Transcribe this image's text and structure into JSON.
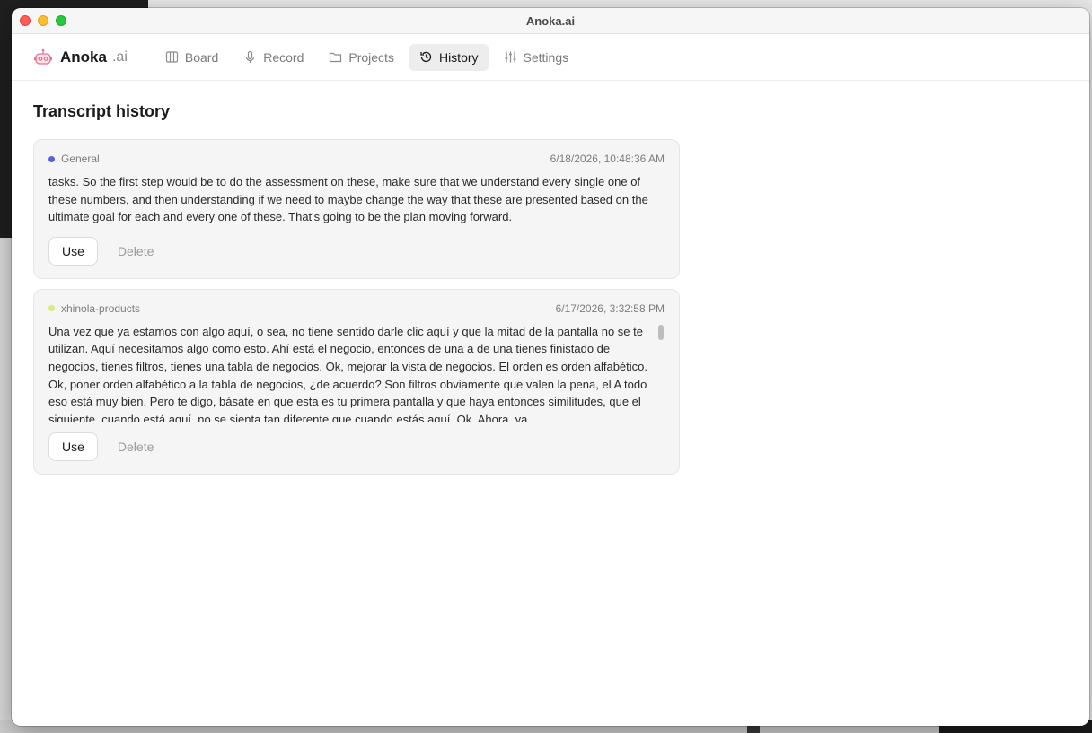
{
  "window": {
    "title": "Anoka.ai"
  },
  "brand": {
    "name": "Anoka",
    "suffix": ".ai"
  },
  "nav": [
    {
      "label": "Board",
      "icon": "board-icon",
      "active": false
    },
    {
      "label": "Record",
      "icon": "mic-icon",
      "active": false
    },
    {
      "label": "Projects",
      "icon": "folder-icon",
      "active": false
    },
    {
      "label": "History",
      "icon": "history-icon",
      "active": true
    },
    {
      "label": "Settings",
      "icon": "sliders-icon",
      "active": false
    }
  ],
  "page": {
    "title": "Transcript history"
  },
  "entries": [
    {
      "project": "General",
      "project_color": "#5b5ce2",
      "timestamp": "6/18/2026, 10:48:36 AM",
      "text": "tasks. So the first step would be to do the assessment on these, make sure that we understand every single one of these numbers, and then understanding if we need to maybe change the way that these are presented based on the ultimate goal for each and every one of these. That's going to be the plan moving forward.",
      "use_label": "Use",
      "delete_label": "Delete"
    },
    {
      "project": "xhinola-products",
      "project_color": "#d8ee7a",
      "timestamp": "6/17/2026, 3:32:58 PM",
      "text": "Una vez que ya estamos con algo aquí, o sea, no tiene sentido darle clic aquí y que la mitad de la pantalla no se te utilizan. Aquí necesitamos algo como esto. Ahí está el negocio, entonces de una a de una tienes finistado de negocios, tienes filtros, tienes una tabla de negocios. Ok, mejorar la vista de negocios. El orden es orden alfabético. Ok, poner orden alfabético a la tabla de negocios, ¿de acuerdo? Son filtros obviamente que valen la pena, el A todo eso está muy bien. Pero te digo, básate en que esta es tu primera pantalla y que haya entonces similitudes, que el siguiente, cuando está aquí, no se sienta tan diferente que cuando estás aquí. Ok. Ahora, ya",
      "use_label": "Use",
      "delete_label": "Delete"
    }
  ]
}
